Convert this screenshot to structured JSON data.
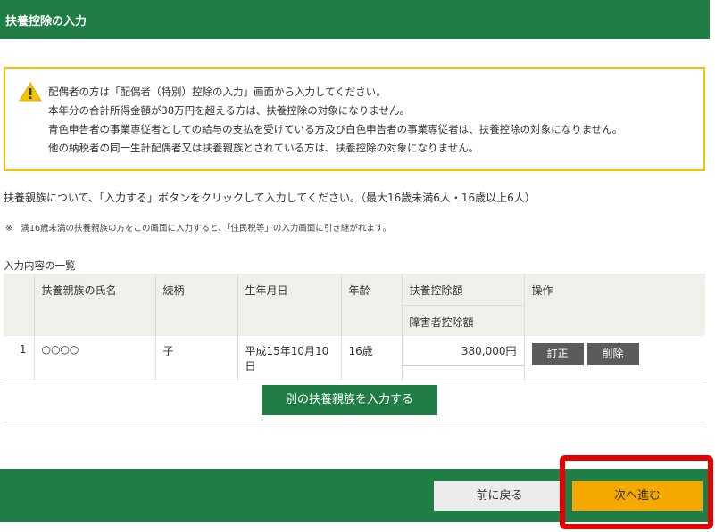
{
  "header": {
    "title": "扶養控除の入力"
  },
  "warning": {
    "lines": [
      "配偶者の方は「配偶者（特別）控除の入力」画面から入力してください。",
      "本年分の合計所得金額が38万円を超える方は、扶養控除の対象になりません。",
      "青色申告者の事業専従者としての給与の支払を受けている方及び白色申告者の事業専従者は、扶養控除の対象になりません。",
      "他の納税者の同一生計配偶者又は扶養親族とされている方は、扶養控除の対象になりません。"
    ]
  },
  "instruction": "扶養親族について、「入力する」ボタンをクリックして入力してください。（最大16歳未満6人・16歳以上6人）",
  "note": "※　満16歳未満の扶養親族の方をこの画面に入力すると、「住民税等」の入力画面に引き継がれます。",
  "list_title": "入力内容の一覧",
  "table": {
    "headers": {
      "name": "扶養親族の氏名",
      "relation": "続柄",
      "birthdate": "生年月日",
      "age": "年齢",
      "deduction": "扶養控除額",
      "disability": "障害者控除額",
      "actions": "操作"
    },
    "rows": [
      {
        "no": "1",
        "name": "○○○○",
        "relation": "子",
        "birthdate": "平成15年10月10日",
        "age": "16歳",
        "deduction": "380,000円",
        "disability": "",
        "edit_label": "訂正",
        "delete_label": "削除"
      }
    ]
  },
  "add_button": "別の扶養親族を入力する",
  "footer": {
    "back_label": "前に戻る",
    "next_label": "次へ進む"
  },
  "colors": {
    "brand_green": "#1f7d45",
    "warning_border": "#f2c500",
    "next_button": "#f5a800",
    "highlight": "#e60000"
  }
}
